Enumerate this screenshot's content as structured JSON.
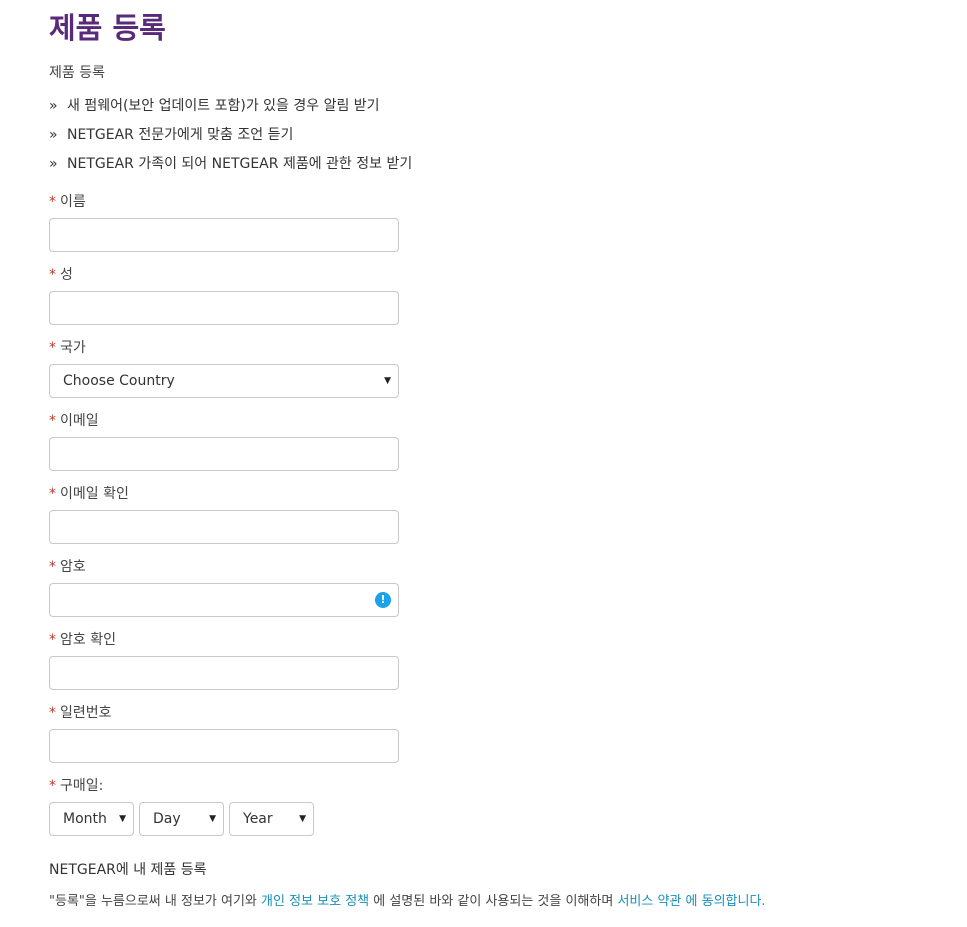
{
  "page": {
    "title": "제품 등록",
    "subtitle": "제품 등록"
  },
  "benefits": {
    "marker": "»",
    "items": [
      "새 펌웨어(보안 업데이트 포함)가 있을 경우 알림 받기",
      "NETGEAR 전문가에게 맞춤 조언 듣기",
      "NETGEAR 가족이 되어 NETGEAR 제품에 관한 정보 받기"
    ]
  },
  "form": {
    "required_mark": "*",
    "first_name": {
      "label": "이름",
      "value": ""
    },
    "last_name": {
      "label": "성",
      "value": ""
    },
    "country": {
      "label": "국가",
      "selected": "Choose Country"
    },
    "email": {
      "label": "이메일",
      "value": ""
    },
    "email_confirm": {
      "label": "이메일 확인",
      "value": ""
    },
    "password": {
      "label": "암호",
      "value": "",
      "hint_icon": "info-icon",
      "hint_icon_glyph": "!"
    },
    "password_confirm": {
      "label": "암호 확인",
      "value": ""
    },
    "serial": {
      "label": "일련번호",
      "value": ""
    },
    "purchase_date": {
      "label": "구매일:",
      "month": "Month",
      "day": "Day",
      "year": "Year"
    },
    "caret": "▼"
  },
  "registration": {
    "heading": "NETGEAR에 내 제품 등록",
    "consent_prefix": "\"등록\"을 누름으로써 내 정보가 여기와 ",
    "privacy_link": "개인 정보 보호 정책",
    "consent_middle": " 에 설명된 바와 같이 사용되는 것을 이해하며 ",
    "terms_link": "서비스 약관",
    "consent_suffix": " 에 동의합니다."
  },
  "colors": {
    "title": "#5a2a7a",
    "required": "#c0392b",
    "link": "#1a8fb8",
    "info_icon": "#1aa3e8"
  }
}
